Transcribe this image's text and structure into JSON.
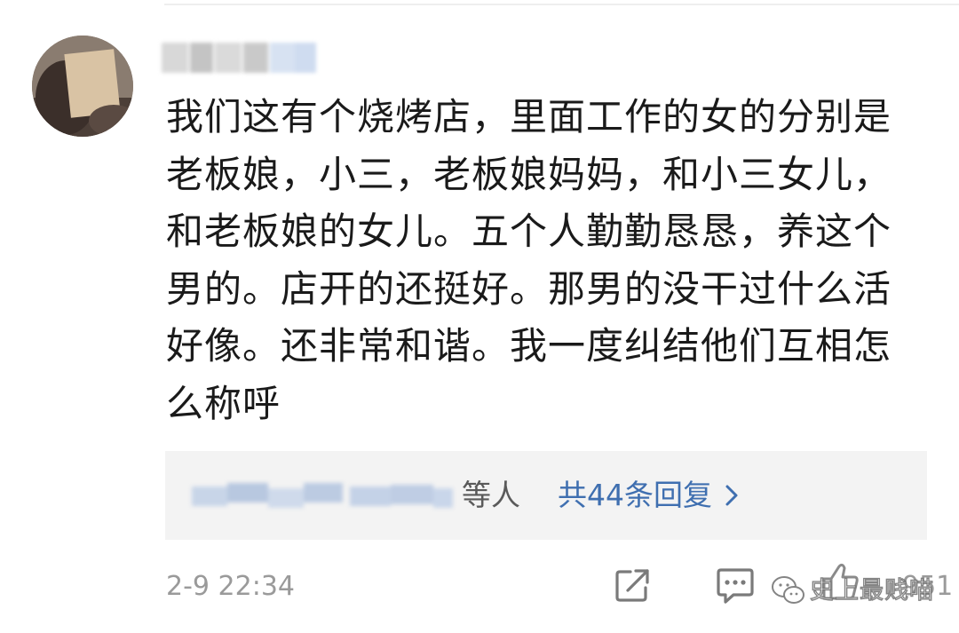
{
  "comment": {
    "author_name": "",
    "lines": [
      "我们这有个烧烤店，里面工作的女的分别是",
      "老板娘，小三，老板娘妈妈，和小三女儿，",
      "和老板娘的女儿。五个人勤勤恳恳，养这个",
      "男的。店开的还挺好。那男的没干过什么活",
      "好像。还非常和谐。我一度纠结他们互相怎",
      "么称呼"
    ],
    "timestamp": "2-9 22:34"
  },
  "replies": {
    "suffix": "等人",
    "link_label": "共44条回复"
  },
  "actions": {
    "like_count": "951"
  },
  "watermark": {
    "text": "史上最贱喵"
  },
  "colors": {
    "text": "#1a1a1a",
    "link": "#3f6fb0",
    "muted": "#9a9a9a",
    "reply_bg": "#f3f3f3"
  },
  "icons": {
    "share": "share-icon",
    "comment": "comment-icon",
    "like": "thumbs-up-icon",
    "chevron": "chevron-right-icon",
    "watermark": "wechat-icon"
  }
}
